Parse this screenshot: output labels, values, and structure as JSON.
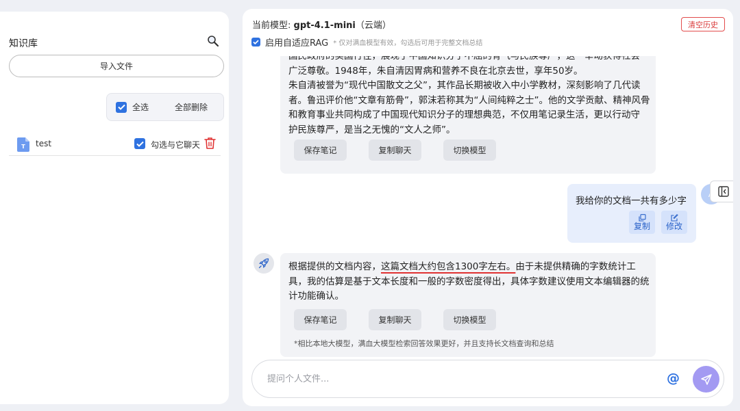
{
  "sidebar": {
    "title": "知识库",
    "import_label": "导入文件",
    "select_all_label": "全选",
    "delete_all_label": "全部删除",
    "files": [
      {
        "icon_letter": "T",
        "name": "test",
        "chat_label": "勾选与它聊天",
        "checked": true
      }
    ]
  },
  "header": {
    "model_prefix": "当前模型: ",
    "model_name": "gpt-4.1-mini",
    "model_suffix": "（云端）",
    "clear_label": "清空历史",
    "rag_label": "启用自适应RAG",
    "rag_note": "* 仅对满血模型有效，勾选后可用于完整文档总结"
  },
  "messages": {
    "ai_1": {
      "lines": [
        "国民政府的卖国行径，展现了中国知识分子不屈的骨气与民族尊严，这一举动获得社会",
        "广泛尊敬。1948年，朱自清因胃病和营养不良在北京去世，享年50岁。",
        "朱自清被誉为“现代中国散文之父”，其作品长期被收入中小学教材，深刻影响了几代读",
        "者。鲁迅评价他“文章有筋骨”，郭沫若称其为“人间纯粹之士”。他的文学贡献、精神风骨",
        "和教育事业共同构成了中国现代知识分子的理想典范，不仅用笔记录生活，更以行动守",
        "护民族尊严，是当之无愧的“文人之师”。"
      ],
      "actions": [
        "保存笔记",
        "复制聊天",
        "切换模型"
      ]
    },
    "user_1": {
      "text": "我给你的文档一共有多少字",
      "copy_label": "复制",
      "edit_label": "修改"
    },
    "ai_2": {
      "text_before": "根据提供的文档内容，",
      "text_highlight": "这篇文档大约包含1300字左右。",
      "text_after": "由于未提供精确的字数统计工具，我的估算是基于文本长度和一般的字数密度得出，具体字数建议使用文本编辑器的统计功能确认。",
      "actions": [
        "保存笔记",
        "复制聊天",
        "切换模型"
      ],
      "footnote": "*相比本地大模型，满血大模型检索回答效果更好，并且支持长文档查询和总结"
    }
  },
  "input": {
    "placeholder": "提问个人文件...",
    "at_label": "@"
  },
  "colors": {
    "accent": "#2f72e0",
    "danger": "#e03131",
    "send": "#a39af2",
    "user_bubble": "#e7eefc",
    "ai_bubble": "#f2f3f6"
  }
}
